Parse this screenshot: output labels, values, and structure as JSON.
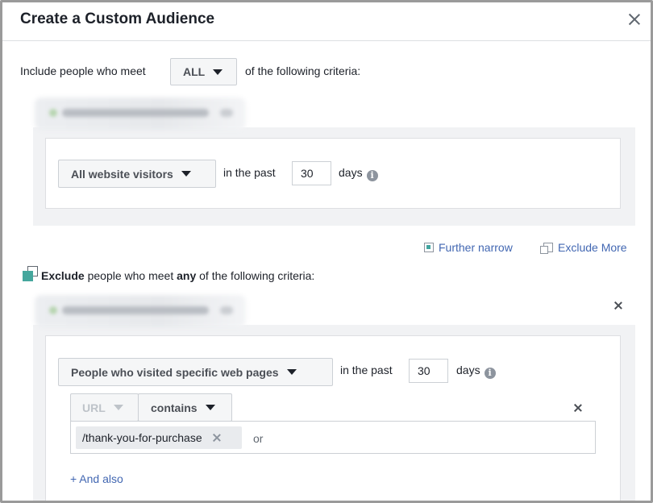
{
  "dialog": {
    "title": "Create a Custom Audience"
  },
  "include": {
    "prefix": "Include people who meet",
    "match_value": "ALL",
    "suffix": "of the following criteria:",
    "rule": {
      "source": "All website visitors",
      "in_the_past": "in the past",
      "days_value": "30",
      "days_label": "days",
      "info_icon": "i"
    }
  },
  "actions": {
    "further_narrow": "Further narrow",
    "exclude_more": "Exclude More"
  },
  "exclude": {
    "word_exclude": "Exclude",
    "middle": "people who meet",
    "word_any": "any",
    "suffix": "of the following criteria:",
    "rule": {
      "source": "People who visited specific web pages",
      "in_the_past": "in the past",
      "days_value": "30",
      "days_label": "days",
      "info_icon": "i",
      "field": "URL",
      "operator": "contains",
      "tag_value": "/thank-you-for-purchase",
      "or_text": "or",
      "and_also": "+ And also"
    }
  },
  "icons": {
    "close": "close-icon",
    "caret": "caret-down-icon",
    "info": "info-icon",
    "further_narrow": "narrow-icon",
    "exclude_more": "exclude-icon"
  },
  "colors": {
    "link": "#4267b2",
    "exclude_accent": "#45a79d",
    "text": "#1d2129"
  }
}
